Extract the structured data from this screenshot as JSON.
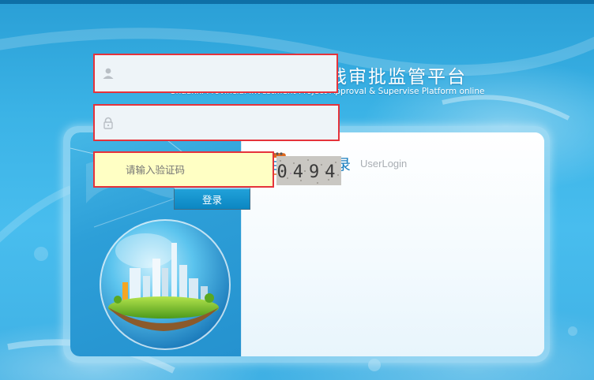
{
  "header": {
    "title": "陕西省投资项目在线审批监管平台",
    "subtitle": "Shaanxi  Provincial Investment Project Approval & Supervise Platform online"
  },
  "login": {
    "title": "用户登录",
    "title_en": "UserLogin",
    "username": {
      "value": "",
      "icon": "user-icon"
    },
    "password": {
      "value": "",
      "icon": "lock-icon"
    },
    "captcha": {
      "placeholder": "请输入验证码",
      "code": "0494"
    },
    "submit_label": "登录"
  },
  "colors": {
    "background": "#3bb3e6",
    "accent": "#1c7fbf",
    "field_border": "#e5333b",
    "captcha_field": "#ffffc4",
    "button": "#0b86c2"
  }
}
